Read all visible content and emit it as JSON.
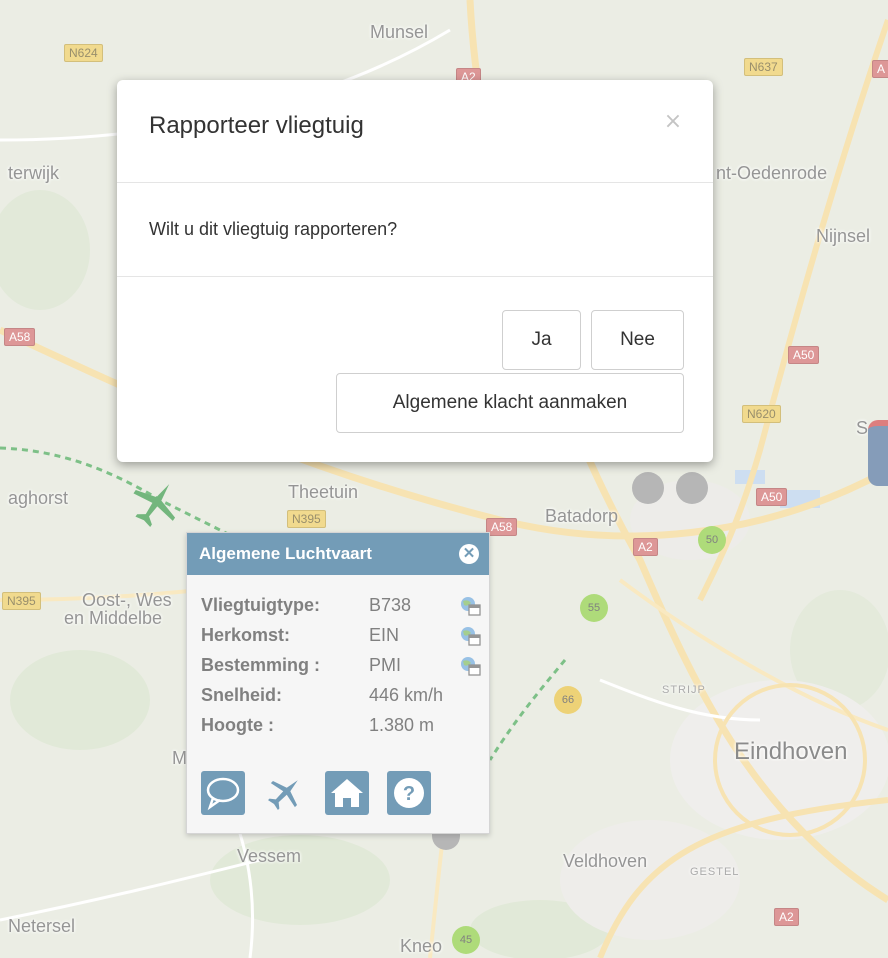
{
  "map": {
    "places": [
      "Munsel",
      "terwijk",
      "nt-Oedenrode",
      "Nijnsel",
      "aghorst",
      "Theetuin",
      "Batadorp",
      "Oost-, Wes",
      "en Middelbe",
      "M",
      "Eindhoven",
      "Vessem",
      "Veldhoven",
      "Netersel",
      "Kneo",
      "S"
    ],
    "districts": [
      "STRIJP",
      "GESTEL"
    ],
    "road_shields": {
      "yellow": [
        "N624",
        "N637",
        "N395",
        "N395",
        "N620"
      ],
      "red": [
        "A2",
        "A",
        "A58",
        "A50",
        "A58",
        "A50",
        "A2",
        "A2"
      ]
    },
    "clusters": [
      "50",
      "55",
      "66",
      "45"
    ],
    "colors": {
      "map_bg": "#dfe3d4",
      "road_major": "#f3d283",
      "route": "#2e9a3e",
      "aircraft": "#1e8a2e",
      "cluster_green": "#7cc629",
      "cluster_yellow": "#e3b624",
      "cluster_grey": "#8a8a8a"
    }
  },
  "panel": {
    "title": "Algemene Luchtvaart",
    "close_icon": "times-circle-icon",
    "rows": [
      {
        "label": "Vliegtuigtype:",
        "value": "B738",
        "icon": "globe-window-icon"
      },
      {
        "label": "Herkomst:",
        "value": "EIN",
        "icon": "globe-window-icon"
      },
      {
        "label": "Bestemming :",
        "value": "PMI",
        "icon": "globe-window-icon"
      },
      {
        "label": "Snelheid:",
        "value": "446 km/h"
      },
      {
        "label": "Hoogte :",
        "value": "1.380 m"
      }
    ],
    "toolbar_icons": [
      "comment-icon",
      "plane-icon",
      "home-icon",
      "help-icon"
    ],
    "accent": "#1d5f8c"
  },
  "modal": {
    "title": "Rapporteer vliegtuig",
    "close_icon": "×",
    "body": "Wilt u dit vliegtuig rapporteren?",
    "yes_label": "Ja",
    "no_label": "Nee",
    "complaint_label": "Algemene klacht aanmaken"
  }
}
